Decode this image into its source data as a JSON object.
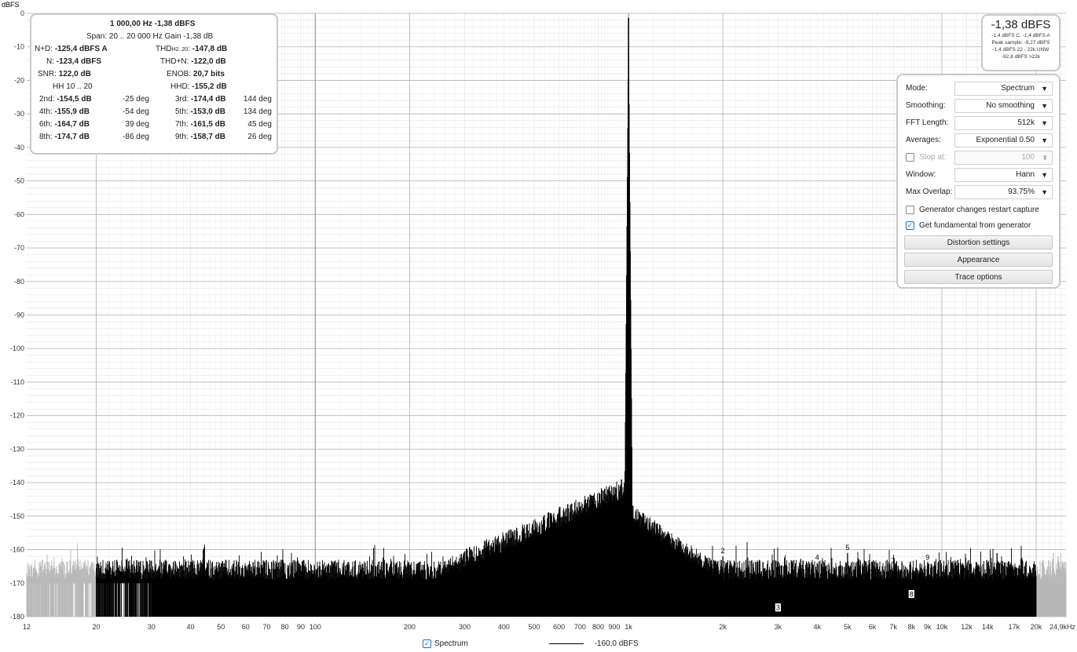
{
  "colors": {
    "trace": "#000000",
    "trace_out_of_band": "#b8b8b8",
    "grid_major": "#b4b4b4",
    "grid_minor": "#e3e3e3",
    "accent": "#1a73c9"
  },
  "chart_data": {
    "type": "line",
    "title": "",
    "ylabel": "dBFS",
    "xlabel": "",
    "x_scale": "log",
    "xlim": [
      12,
      24900
    ],
    "ylim": [
      -180,
      0
    ],
    "y_ticks": [
      "0",
      "-10",
      "-20",
      "-30",
      "-40",
      "-50",
      "-60",
      "-70",
      "-80",
      "-90",
      "-100",
      "-110",
      "-120",
      "-130",
      "-140",
      "-150",
      "-160",
      "-170",
      "-180"
    ],
    "x_ticks": [
      {
        "v": 12,
        "label": "12"
      },
      {
        "v": 20,
        "label": "20"
      },
      {
        "v": 30,
        "label": "30"
      },
      {
        "v": 40,
        "label": "40"
      },
      {
        "v": 50,
        "label": "50"
      },
      {
        "v": 60,
        "label": "60"
      },
      {
        "v": 70,
        "label": "70"
      },
      {
        "v": 80,
        "label": "80"
      },
      {
        "v": 90,
        "label": "90"
      },
      {
        "v": 100,
        "label": "100"
      },
      {
        "v": 200,
        "label": "200"
      },
      {
        "v": 300,
        "label": "300"
      },
      {
        "v": 400,
        "label": "400"
      },
      {
        "v": 500,
        "label": "500"
      },
      {
        "v": 600,
        "label": "600"
      },
      {
        "v": 700,
        "label": "700"
      },
      {
        "v": 800,
        "label": "800"
      },
      {
        "v": 900,
        "label": "900"
      },
      {
        "v": 1000,
        "label": "1k"
      },
      {
        "v": 2000,
        "label": "2k"
      },
      {
        "v": 3000,
        "label": "3k"
      },
      {
        "v": 4000,
        "label": "4k"
      },
      {
        "v": 5000,
        "label": "5k"
      },
      {
        "v": 6000,
        "label": "6k"
      },
      {
        "v": 7000,
        "label": "7k"
      },
      {
        "v": 8000,
        "label": "8k"
      },
      {
        "v": 9000,
        "label": "9k"
      },
      {
        "v": 10000,
        "label": "10k"
      },
      {
        "v": 12000,
        "label": "12k"
      },
      {
        "v": 14000,
        "label": "14k"
      },
      {
        "v": 17000,
        "label": "17k"
      },
      {
        "v": 20000,
        "label": "20k"
      },
      {
        "v": 24900,
        "label": "24,9kHz"
      }
    ],
    "fundamental": {
      "freq": 1000,
      "level": -1.38
    },
    "noise_floor": {
      "min": -180,
      "max": -163
    },
    "harmonic_markers": [
      {
        "n": "2",
        "freq": 2000,
        "level": -162
      },
      {
        "n": "3",
        "freq": 3000,
        "level": -179
      },
      {
        "n": "4",
        "freq": 4000,
        "level": -164
      },
      {
        "n": "5",
        "freq": 5000,
        "level": -161
      },
      {
        "n": "6",
        "freq": 6000,
        "level": -168
      },
      {
        "n": "7",
        "freq": 7000,
        "level": -165
      },
      {
        "n": "8",
        "freq": 8000,
        "level": -175
      },
      {
        "n": "9",
        "freq": 9000,
        "level": -164
      }
    ],
    "spurs": [
      {
        "freq": 2000,
        "level": -162
      },
      {
        "freq": 4000,
        "level": -164
      },
      {
        "freq": 5000,
        "level": -161
      },
      {
        "freq": 9000,
        "level": -164
      },
      {
        "freq": 15000,
        "level": -161
      },
      {
        "freq": 22700,
        "level": -161
      },
      {
        "freq": 23500,
        "level": -162
      }
    ],
    "legend": {
      "label": "Spectrum",
      "value": "-160,0 dBFS",
      "checked": true
    }
  },
  "stats": {
    "freq_line": "1 000,00 Hz  -1,38 dBFS",
    "span_line": "Span: 20 .. 20 000 Hz  Gain -1,38 dB",
    "nd_label": "N+D:",
    "nd_value": "-125,4 dBFS A",
    "thd_label": "THD",
    "thd_sub": "H2..20",
    "thd_value": "-147,8 dB",
    "n_label": "N:",
    "n_value": "-123,4 dBFS",
    "thdn_label": "THD+N:",
    "thdn_value": "-122,0 dB",
    "snr_label": "SNR:",
    "snr_value": "122,0 dB",
    "enob_label": "ENOB:",
    "enob_value": "20,7 bits",
    "hh_label": "HH 10 .. 20",
    "hhd_label": "HHD:",
    "hhd_value": "-155,2 dB",
    "harmonics": [
      {
        "a_label": "2nd:",
        "a_val": "-154,5 dB",
        "a_deg": "-25 deg",
        "b_label": "3rd:",
        "b_val": "-174,4 dB",
        "b_deg": "144 deg"
      },
      {
        "a_label": "4th:",
        "a_val": "-155,9 dB",
        "a_deg": "-54 deg",
        "b_label": "5th:",
        "b_val": "-153,0 dB",
        "b_deg": "134 deg"
      },
      {
        "a_label": "6th:",
        "a_val": "-164,7 dB",
        "a_deg": "39 deg",
        "b_label": "7th:",
        "b_val": "-161,5 dB",
        "b_deg": "45 deg"
      },
      {
        "a_label": "8th:",
        "a_val": "-174,7 dB",
        "a_deg": "-86 deg",
        "b_label": "9th:",
        "b_val": "-158,7 dB",
        "b_deg": "26 deg"
      }
    ]
  },
  "level": {
    "main": "-1,38 dBFS",
    "lines": [
      "-1,4 dBFS C, -1,4 dBFS A",
      "Peak sample: -9,27 dBFS",
      "-1,4 dBFS 22 - 22k UNW",
      "-92,8 dBFS >22k"
    ]
  },
  "controls": {
    "mode_label": "Mode:",
    "mode_value": "Spectrum",
    "smoothing_label": "Smoothing:",
    "smoothing_value": "No smoothing",
    "fft_label": "FFT Length:",
    "fft_value": "512k",
    "averages_label": "Averages:",
    "averages_value": "Exponential 0.50",
    "stop_label": "Stop at:",
    "stop_value": "100",
    "window_label": "Window:",
    "window_value": "Hann",
    "overlap_label": "Max Overlap:",
    "overlap_value": "93.75%",
    "gen_restart_label": "Generator changes restart capture",
    "gen_fund_label": "Get fundamental from generator",
    "distortion_btn": "Distortion settings",
    "appearance_btn": "Appearance",
    "trace_btn": "Trace options"
  }
}
